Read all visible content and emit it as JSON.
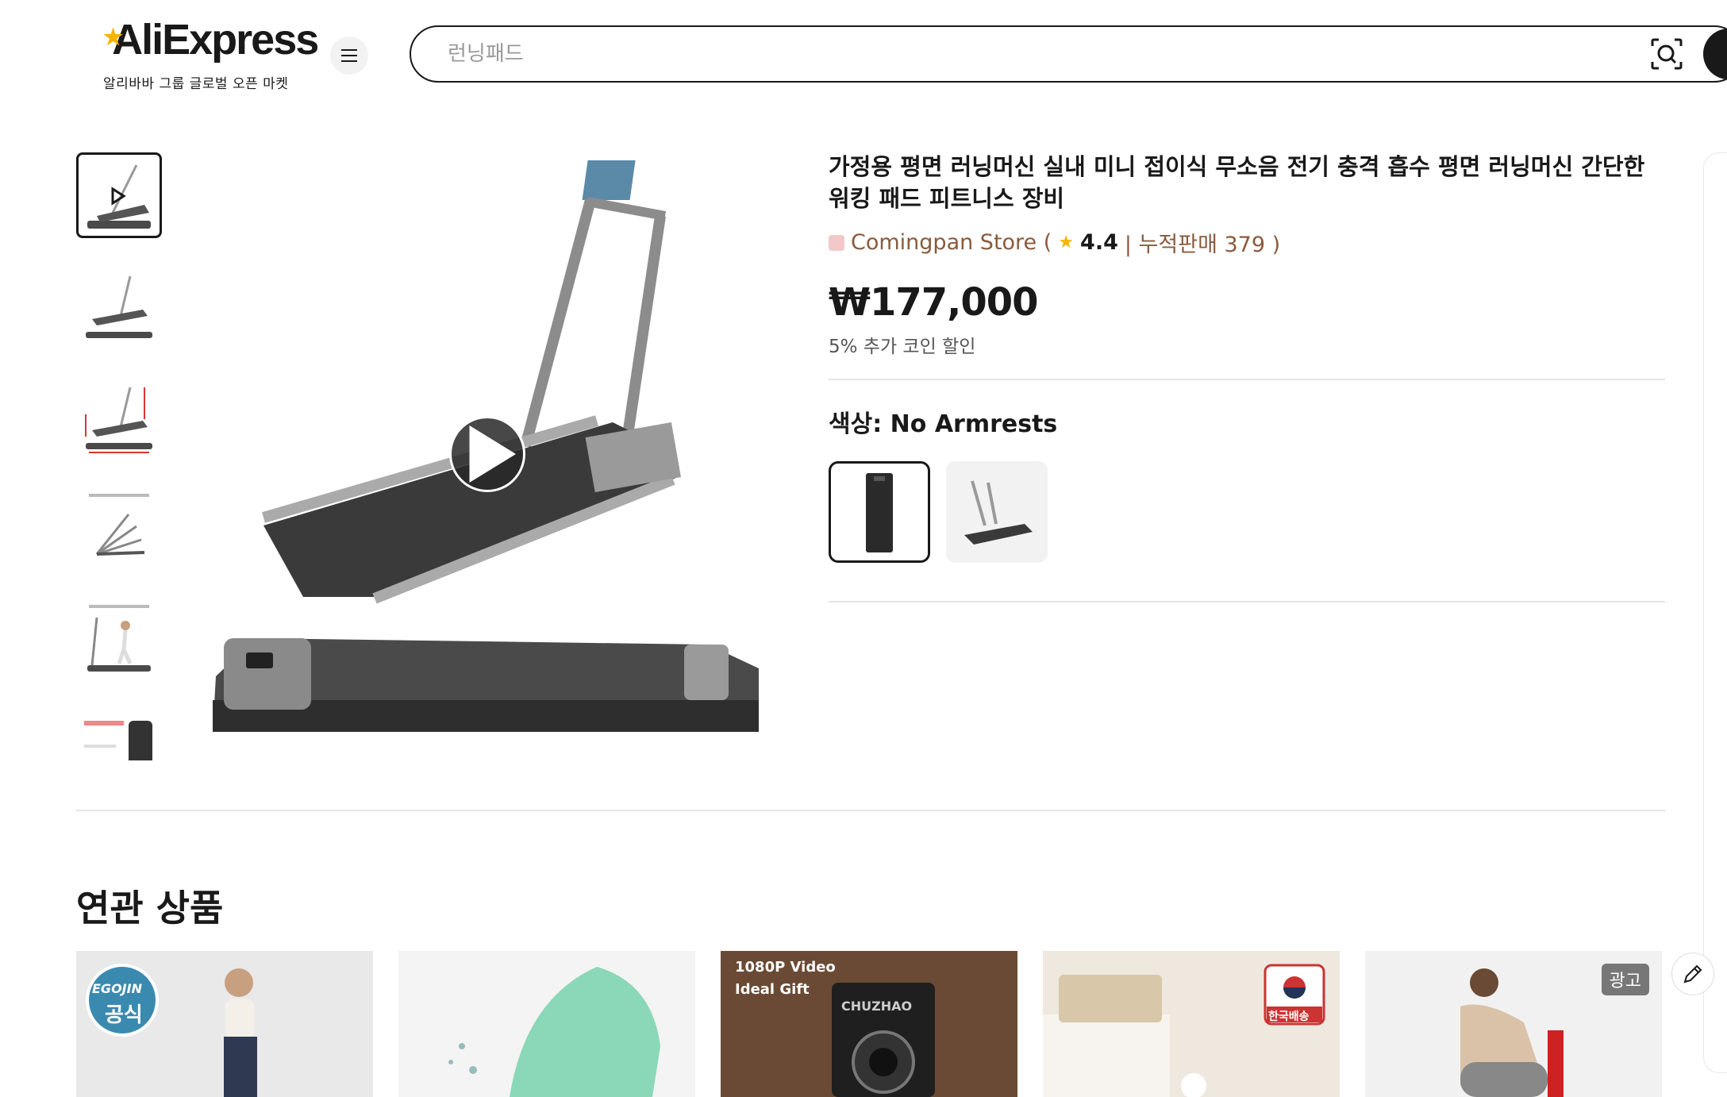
{
  "header": {
    "logo_text": "AliExpress",
    "logo_sub": "알리바바 그룹 글로벌 오픈 마켓",
    "search_placeholder": "런닝패드"
  },
  "gallery": {
    "thumbnail_count": 6,
    "active_index": 0
  },
  "product": {
    "title": "가정용 평면 러닝머신 실내 미니 접이식 무소음 전기 충격 흡수 평면 러닝머신 간단한 워킹 패드 피트니스 장비",
    "store_name": "Comingpan Store (",
    "rating": "4.4",
    "sales_text": "| 누적판매 379 )",
    "price": "₩177,000",
    "coin_discount": "5% 추가 코인 할인",
    "color_label": "색상:",
    "color_value": "No Armrests"
  },
  "related": {
    "title": "연관 상품",
    "cards": [
      {
        "badge_brand": "EGOJIN",
        "badge_sub": "공식"
      },
      {},
      {
        "line1": "1080P Video",
        "line2": "Ideal Gift",
        "brand": "CHUZHAO"
      },
      {
        "badge": "한국배송"
      },
      {
        "ad": "광고"
      }
    ]
  },
  "colors": {
    "accent": "#8a5a3c",
    "star": "#f5b400",
    "text": "#191919"
  }
}
